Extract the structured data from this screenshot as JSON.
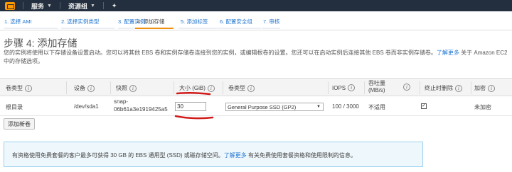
{
  "topnav": {
    "services_label": "服务",
    "resource_groups_label": "资源组",
    "pin_icon": "pin-icon",
    "logo_icon": "aws-cube-icon",
    "background": "#232f3e"
  },
  "steps": [
    {
      "label": "1. 选择 AMI",
      "active": false
    },
    {
      "label": "2. 选择实例类型",
      "active": false
    },
    {
      "label": "3. 配置实例",
      "active": false
    },
    {
      "label": "4. 添加存储",
      "active": true
    },
    {
      "label": "5. 添加标签",
      "active": false
    },
    {
      "label": "6. 配置安全组",
      "active": false
    },
    {
      "label": "7. 审核",
      "active": false
    }
  ],
  "page": {
    "title": "步骤 4: 添加存储",
    "desc_text": "您的实例将使用以下存储设备设置启动。您可以将其他 EBS 卷和实例存储卷连接到您的实例，或编辑根卷的设置。您还可以在启动实例后连接其他 EBS 卷而非实例存储卷。",
    "desc_link": "了解更多",
    "desc_suffix": "关于 Amazon EC2 中的存储选项。"
  },
  "table": {
    "headers": {
      "volume_type": "卷类型",
      "device": "设备",
      "snapshot": "快照",
      "size": "大小 (GiB)",
      "vol_type2": "卷类型",
      "iops": "IOPS",
      "throughput_1": "吞吐量 (MB/s)",
      "delete_on_term": "终止时删除",
      "encrypted": "加密"
    },
    "row": {
      "volume_type": "根目录",
      "device": "/dev/sda1",
      "snapshot_1": "snap-",
      "snapshot_2": "06b61a3e1919425a5",
      "size": "30",
      "vol_type_selected": "General Purpose SSD (GP2)",
      "iops": "100 / 3000",
      "throughput": "不适用",
      "delete_on_term": true,
      "encrypted": "未加密"
    }
  },
  "add_button_label": "添加新卷",
  "notice": {
    "text": "有资格使用免费套餐的客户最多可获得 30 GB 的 EBS 通用型 (SSD) 或磁存储空间。",
    "link": "了解更多",
    "suffix": "有关免费使用套餐资格和使用限制的信息。"
  },
  "colors": {
    "accent_orange": "#f09010",
    "link_blue": "#2176d2",
    "annotation_red": "#d11a1a"
  }
}
